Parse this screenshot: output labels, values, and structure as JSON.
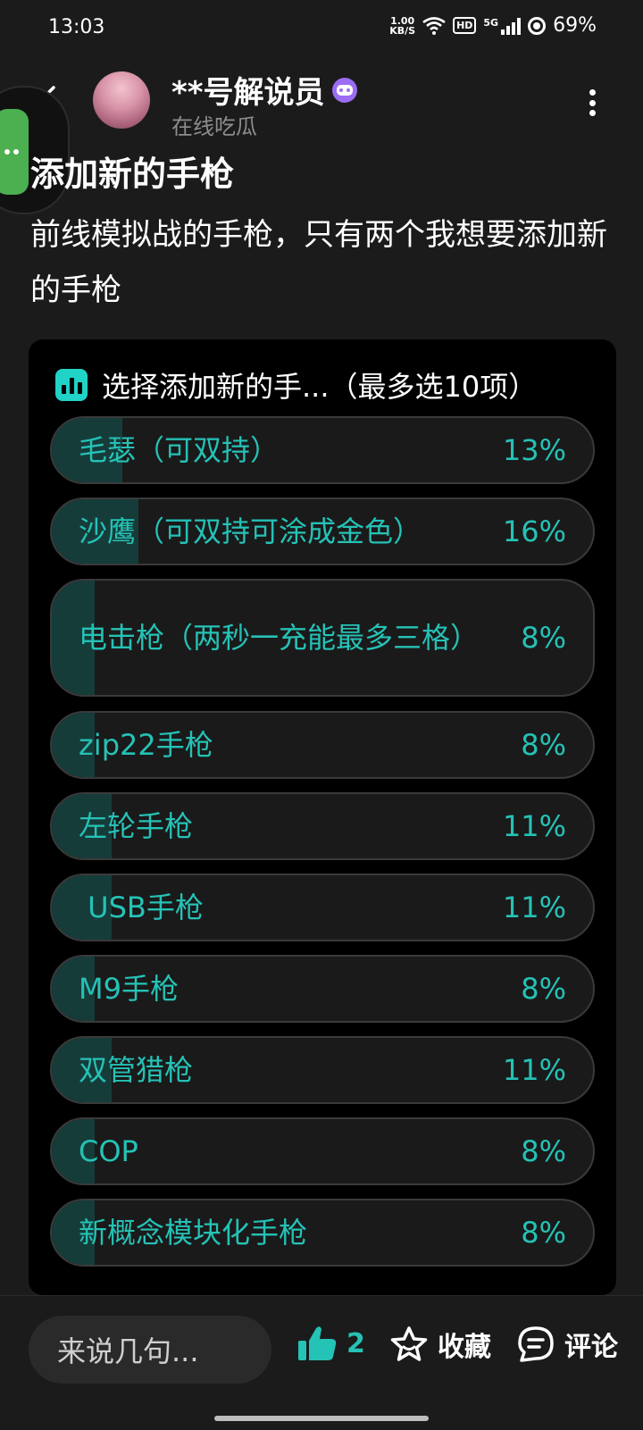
{
  "status": {
    "time": "13:03",
    "netspeed_value": "1.00",
    "netspeed_unit": "KB/S",
    "hd": "HD",
    "network": "5G",
    "battery": "69%"
  },
  "header": {
    "username": "**号解说员",
    "subtitle": "在线吃瓜",
    "back_icon": "back-arrow-icon",
    "more_icon": "more-vertical-icon"
  },
  "post": {
    "title": "添加新的手枪",
    "body": "前线模拟战的手枪，只有两个我想要添加新的手枪"
  },
  "poll": {
    "title": "选择添加新的手...（最多选10项）",
    "accent": "#25c2b6",
    "options": [
      {
        "label": "毛瑟（可双持）",
        "percent": "13%",
        "value": 13
      },
      {
        "label": "沙鹰（可双持可涂成金色）",
        "percent": "16%",
        "value": 16
      },
      {
        "label": "电击枪（两秒一充能最多三格）",
        "percent": "8%",
        "value": 8
      },
      {
        "label": "zip22手枪",
        "percent": "8%",
        "value": 8
      },
      {
        "label": "左轮手枪",
        "percent": "11%",
        "value": 11
      },
      {
        "label": " USB手枪",
        "percent": "11%",
        "value": 11
      },
      {
        "label": "M9手枪",
        "percent": "8%",
        "value": 8
      },
      {
        "label": "双管猎枪",
        "percent": "11%",
        "value": 11
      },
      {
        "label": "COP",
        "percent": "8%",
        "value": 8
      },
      {
        "label": "新概念模块化手枪",
        "percent": "8%",
        "value": 8
      }
    ]
  },
  "bottom": {
    "comment_placeholder": "来说几句...",
    "like_count": "2",
    "favorite_label": "收藏",
    "comment_label": "评论"
  }
}
